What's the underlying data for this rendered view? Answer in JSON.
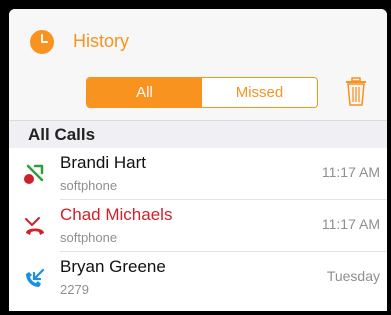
{
  "header": {
    "title": "History",
    "icon": "clock-icon",
    "accent_color": "#f7931e"
  },
  "filter": {
    "all_label": "All",
    "missed_label": "Missed",
    "selected": "All"
  },
  "toolbar": {
    "trash_icon": "trash-icon"
  },
  "section": {
    "title": "All Calls"
  },
  "calls": [
    {
      "name": "Brandi Hart",
      "subtitle": "softphone",
      "time": "11:17 AM",
      "type": "incoming-answered",
      "icon": "call-answered-icon"
    },
    {
      "name": "Chad Michaels",
      "subtitle": "softphone",
      "time": "11:17 AM",
      "type": "missed",
      "icon": "missed-call-icon"
    },
    {
      "name": "Bryan Greene",
      "subtitle": "2279",
      "time": "Tuesday",
      "type": "incoming",
      "icon": "incoming-call-icon"
    }
  ]
}
